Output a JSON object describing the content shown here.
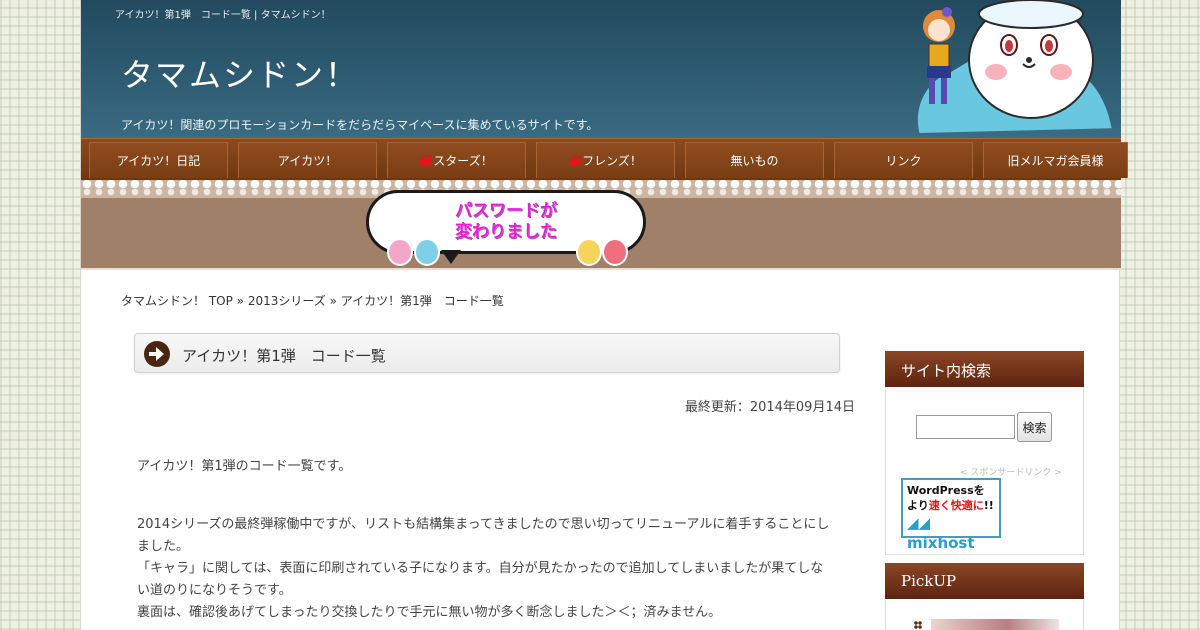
{
  "header": {
    "page_title": "アイカツ！第1弾　コード一覧 | タマムシドン！",
    "site_name": "タマムシドン！",
    "tagline": "アイカツ！関連のプロモーションカードをだらだらマイペースに集めているサイトです。"
  },
  "nav": {
    "items": [
      {
        "label": "アイカツ！日記",
        "locked": false
      },
      {
        "label": "アイカツ！",
        "locked": false
      },
      {
        "label": "スターズ！",
        "locked": true
      },
      {
        "label": "フレンズ！",
        "locked": true
      },
      {
        "label": "無いもの",
        "locked": false
      },
      {
        "label": "リンク",
        "locked": false
      },
      {
        "label": "旧メルマガ会員様",
        "locked": false
      }
    ]
  },
  "banner": {
    "line1": "パスワードが",
    "line2": "変わりました"
  },
  "breadcrumb": {
    "home": "タマムシドン！ TOP",
    "sep": " » ",
    "category": "2013シリーズ",
    "current": "アイカツ！第1弾　コード一覧"
  },
  "article": {
    "title": "アイカツ！第1弾　コード一覧",
    "updated": "最終更新：2014年09月14日",
    "p1": "アイカツ！第1弾のコード一覧です。",
    "p2_l1": "2014シリーズの最終弾稼働中ですが、リストも結構集まってきましたので思い切ってリニューアルに着手することにし",
    "p2_l2": "ました。",
    "p2_l3": "「キャラ」に関しては、表面に印刷されている子になります。自分が見たかったので追加してしまいましたが果てしな",
    "p2_l4": "い道のりになりそうです。",
    "p2_l5": "裏面は、確認後あげてしまったり交換したりで手元に無い物が多く断念しました＞＜；済みません。"
  },
  "sidebar": {
    "search_heading": "サイト内検索",
    "search_button": "検索",
    "search_value": "",
    "sponsor_label": "< スポンサードリンク >",
    "ad_line1": "WordPressを",
    "ad_line2_pre": "より",
    "ad_line2_em": "速く快適に",
    "ad_line2_post": "!!",
    "ad_logo": "mixhost",
    "pickup_heading": "PickUP"
  },
  "colors": {
    "header_bg": "#2f5d74",
    "nav_bg": "#7a3d14",
    "banner_bg": "#a08068",
    "bubble_text": "#e81bd8",
    "sidebar_head": "#6e2e16",
    "lock": "#e0141a"
  }
}
